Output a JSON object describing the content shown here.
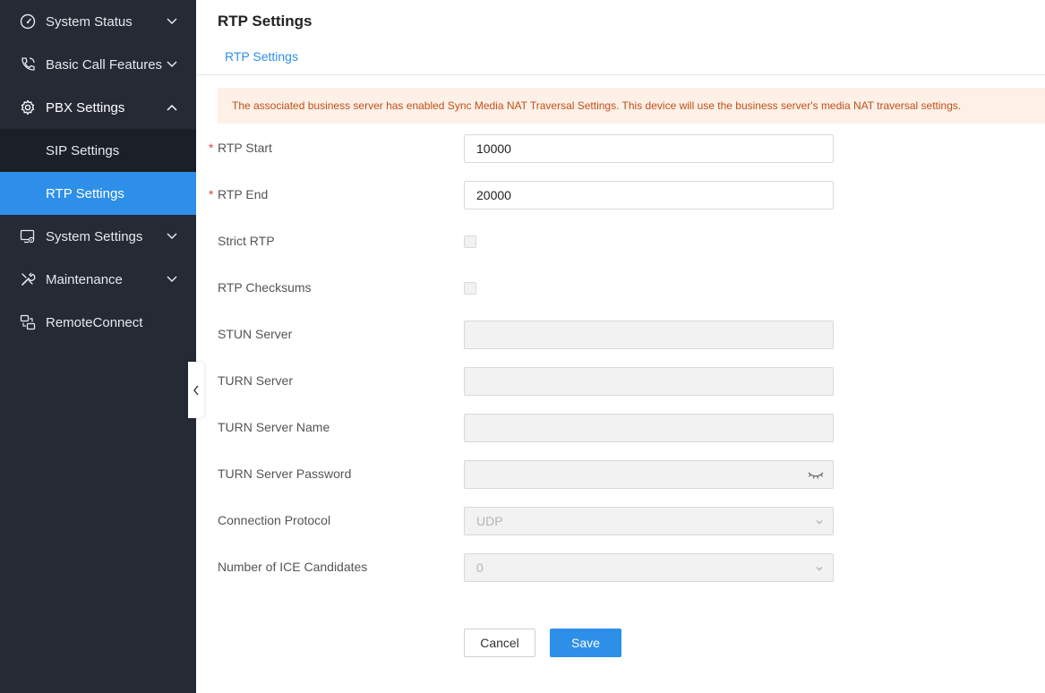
{
  "sidebar": {
    "items": [
      {
        "label": "System Status",
        "icon": "gauge-icon"
      },
      {
        "label": "Basic Call Features",
        "icon": "phone-icon"
      },
      {
        "label": "PBX Settings",
        "icon": "gear-icon"
      },
      {
        "label": "System Settings",
        "icon": "monitor-gear-icon"
      },
      {
        "label": "Maintenance",
        "icon": "tools-icon"
      },
      {
        "label": "RemoteConnect",
        "icon": "remote-connect-icon"
      }
    ],
    "pbx_sub": [
      {
        "label": "SIP Settings"
      },
      {
        "label": "RTP Settings",
        "active": true
      }
    ]
  },
  "header": {
    "title": "RTP Settings",
    "tab": "RTP Settings"
  },
  "notice": "The associated business server has enabled Sync Media NAT Traversal Settings. This device will use the business server's media NAT traversal settings.",
  "form": {
    "rtp_start": {
      "label": "RTP Start",
      "value": "10000"
    },
    "rtp_end": {
      "label": "RTP End",
      "value": "20000"
    },
    "strict_rtp": {
      "label": "Strict RTP"
    },
    "rtp_checksums": {
      "label": "RTP Checksums"
    },
    "stun_server": {
      "label": "STUN Server",
      "value": ""
    },
    "turn_server": {
      "label": "TURN Server",
      "value": ""
    },
    "turn_server_name": {
      "label": "TURN Server Name",
      "value": ""
    },
    "turn_server_password": {
      "label": "TURN Server Password",
      "value": ""
    },
    "connection_protocol": {
      "label": "Connection Protocol",
      "value": "UDP"
    },
    "ice_candidates": {
      "label": "Number of ICE Candidates",
      "value": "0"
    }
  },
  "buttons": {
    "cancel": "Cancel",
    "save": "Save"
  },
  "colors": {
    "accent": "#2d8fe8",
    "sidebar_bg": "#252a35",
    "notice_bg": "#fdf0e6",
    "notice_text": "#c0501a",
    "required": "#e0443e"
  }
}
